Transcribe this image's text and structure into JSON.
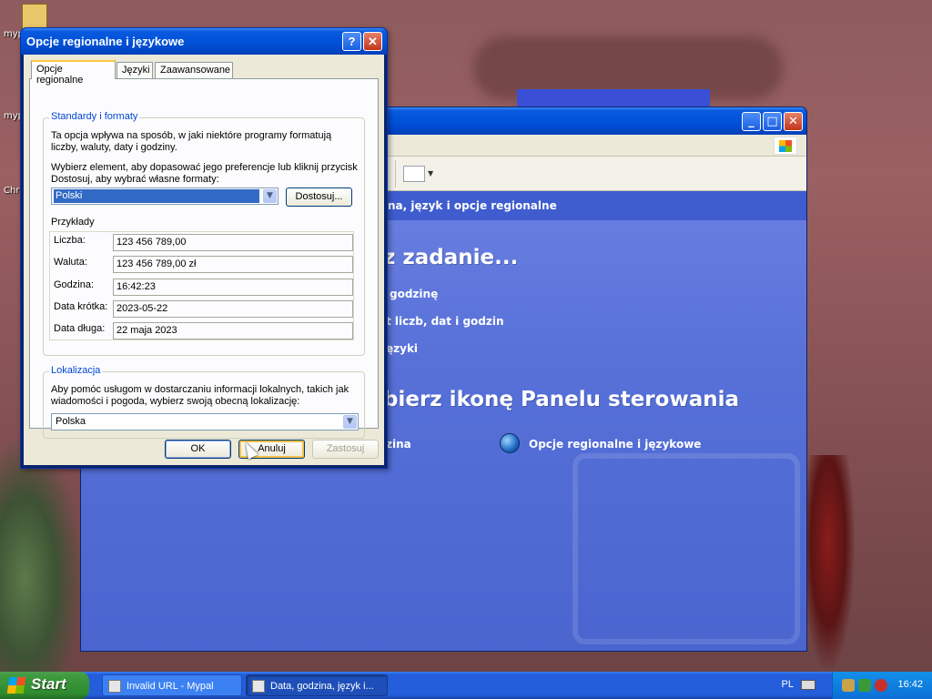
{
  "desktop": {
    "icons": [
      {
        "label": "myp"
      },
      {
        "label": "myp"
      },
      {
        "label": "Chr"
      }
    ]
  },
  "control_panel": {
    "address_text": "na, język i opcje regionalne",
    "heading_task": "z zadanie...",
    "task_links": [
      "godzinę",
      "t liczb, dat i godzin",
      "ęzyki"
    ],
    "heading_icon": "bierz ikonę Panelu sterowania",
    "icon_links": [
      "zina",
      "Opcje regionalne i językowe"
    ],
    "title_buttons": {
      "minimize": "_",
      "maximize": "□",
      "close": "✕"
    }
  },
  "dialog": {
    "title": "Opcje regionalne i językowe",
    "help_button": "?",
    "close_button": "✕",
    "tabs": [
      "Opcje regionalne",
      "Języki",
      "Zaawansowane"
    ],
    "standards": {
      "legend": "Standardy i formaty",
      "description": "Ta opcja wpływa na sposób, w jaki niektóre programy formatują liczby, waluty, daty i godziny.",
      "instruction": "Wybierz element, aby dopasować jego preferencje lub kliknij przycisk Dostosuj, aby wybrać własne formaty:",
      "selected_format": "Polski",
      "customize_button": "Dostosuj...",
      "examples_label": "Przykłady",
      "examples": [
        {
          "label": "Liczba:",
          "value": "123 456 789,00"
        },
        {
          "label": "Waluta:",
          "value": "123 456 789,00 zł"
        },
        {
          "label": "Godzina:",
          "value": "16:42:23"
        },
        {
          "label": "Data krótka:",
          "value": "2023-05-22"
        },
        {
          "label": "Data długa:",
          "value": "22 maja 2023"
        }
      ]
    },
    "location": {
      "legend": "Lokalizacja",
      "description": "Aby pomóc usługom w dostarczaniu informacji lokalnych, takich jak wiadomości i pogoda, wybierz swoją obecną lokalizację:",
      "selected_location": "Polska"
    },
    "buttons": {
      "ok": "OK",
      "cancel": "Anuluj",
      "apply": "Zastosuj"
    }
  },
  "taskbar": {
    "start_label": "Start",
    "tasks": [
      {
        "label": "Invalid URL - Mypal"
      },
      {
        "label": "Data, godzina, język i..."
      }
    ],
    "language": "PL",
    "clock": "16:42"
  }
}
